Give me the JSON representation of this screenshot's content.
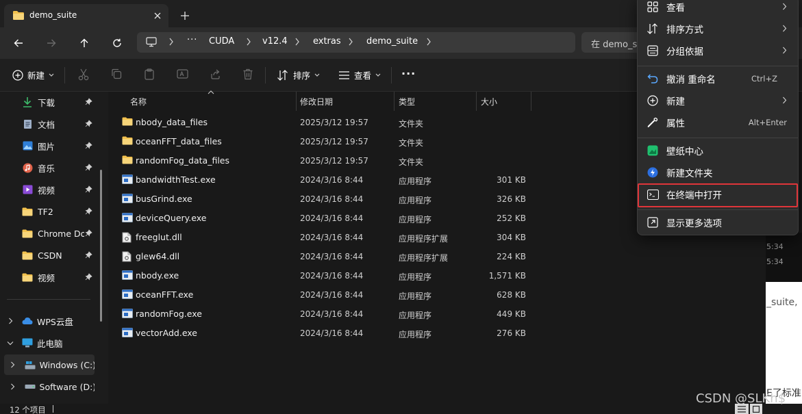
{
  "tab": {
    "title": "demo_suite",
    "close_icon": "close-icon",
    "new_tab_icon": "plus-icon"
  },
  "nav": {
    "back_icon": "arrow-left-icon",
    "forward_icon": "arrow-right-icon",
    "up_icon": "arrow-up-icon",
    "refresh_icon": "refresh-icon"
  },
  "address": {
    "more": "···",
    "crumbs": [
      "CUDA",
      "v12.4",
      "extras",
      "demo_suite"
    ]
  },
  "search": {
    "placeholder": "在 demo_s"
  },
  "toolbar": {
    "new_label": "新建",
    "sort_label": "排序",
    "view_label": "查看",
    "more": "···"
  },
  "sidebar": {
    "quick": [
      {
        "label": "下载",
        "icon": "download-icon"
      },
      {
        "label": "文档",
        "icon": "document-icon"
      },
      {
        "label": "图片",
        "icon": "picture-icon"
      },
      {
        "label": "音乐",
        "icon": "music-icon"
      },
      {
        "label": "视频",
        "icon": "video-icon"
      },
      {
        "label": "TF2",
        "icon": "folder-icon"
      },
      {
        "label": "Chrome Do",
        "icon": "folder-icon"
      },
      {
        "label": "CSDN",
        "icon": "folder-icon"
      },
      {
        "label": "视频",
        "icon": "folder-icon"
      }
    ],
    "tree": [
      {
        "label": "WPS云盘",
        "icon": "cloud-icon"
      },
      {
        "label": "此电脑",
        "icon": "computer-icon"
      },
      {
        "label": "Windows (C:)",
        "icon": "drive-c-icon"
      },
      {
        "label": "Software (D:)",
        "icon": "drive-d-icon"
      }
    ]
  },
  "columns": {
    "name": "名称",
    "date": "修改日期",
    "type": "类型",
    "size": "大小"
  },
  "files": [
    {
      "name": "nbody_data_files",
      "date": "2025/3/12 19:57",
      "type": "文件夹",
      "size": "",
      "kind": "folder"
    },
    {
      "name": "oceanFFT_data_files",
      "date": "2025/3/12 19:57",
      "type": "文件夹",
      "size": "",
      "kind": "folder"
    },
    {
      "name": "randomFog_data_files",
      "date": "2025/3/12 19:57",
      "type": "文件夹",
      "size": "",
      "kind": "folder"
    },
    {
      "name": "bandwidthTest.exe",
      "date": "2024/3/16 8:44",
      "type": "应用程序",
      "size": "301 KB",
      "kind": "exe"
    },
    {
      "name": "busGrind.exe",
      "date": "2024/3/16 8:44",
      "type": "应用程序",
      "size": "326 KB",
      "kind": "exe"
    },
    {
      "name": "deviceQuery.exe",
      "date": "2024/3/16 8:44",
      "type": "应用程序",
      "size": "252 KB",
      "kind": "exe"
    },
    {
      "name": "freeglut.dll",
      "date": "2024/3/16 8:44",
      "type": "应用程序扩展",
      "size": "304 KB",
      "kind": "dll"
    },
    {
      "name": "glew64.dll",
      "date": "2024/3/16 8:44",
      "type": "应用程序扩展",
      "size": "224 KB",
      "kind": "dll"
    },
    {
      "name": "nbody.exe",
      "date": "2024/3/16 8:44",
      "type": "应用程序",
      "size": "1,571 KB",
      "kind": "exe"
    },
    {
      "name": "oceanFFT.exe",
      "date": "2024/3/16 8:44",
      "type": "应用程序",
      "size": "628 KB",
      "kind": "exe"
    },
    {
      "name": "randomFog.exe",
      "date": "2024/3/16 8:44",
      "type": "应用程序",
      "size": "449 KB",
      "kind": "exe"
    },
    {
      "name": "vectorAdd.exe",
      "date": "2024/3/16 8:44",
      "type": "应用程序",
      "size": "276 KB",
      "kind": "exe"
    }
  ],
  "status": {
    "count": "12 个项目"
  },
  "context_menu": {
    "view": "查看",
    "sort": "排序方式",
    "group": "分组依据",
    "undo": "撤消 重命名",
    "undo_shortcut": "Ctrl+Z",
    "new": "新建",
    "properties": "属性",
    "properties_shortcut": "Alt+Enter",
    "wallpaper": "壁纸中心",
    "new_folder": "新建文件夹",
    "open_terminal": "在终端中打开",
    "more_options": "显示更多选项"
  },
  "background": {
    "time1": "5:34",
    "time2": "5:34",
    "snippet1": "_suite,",
    "snippet2": "E了标准"
  },
  "watermark": "CSDN @SLKh$",
  "colors": {
    "folder": "#f2c14e",
    "accent": "#4cc2ff",
    "highlight_box": "#e0353a",
    "menu_bg": "#2c2c2c"
  }
}
